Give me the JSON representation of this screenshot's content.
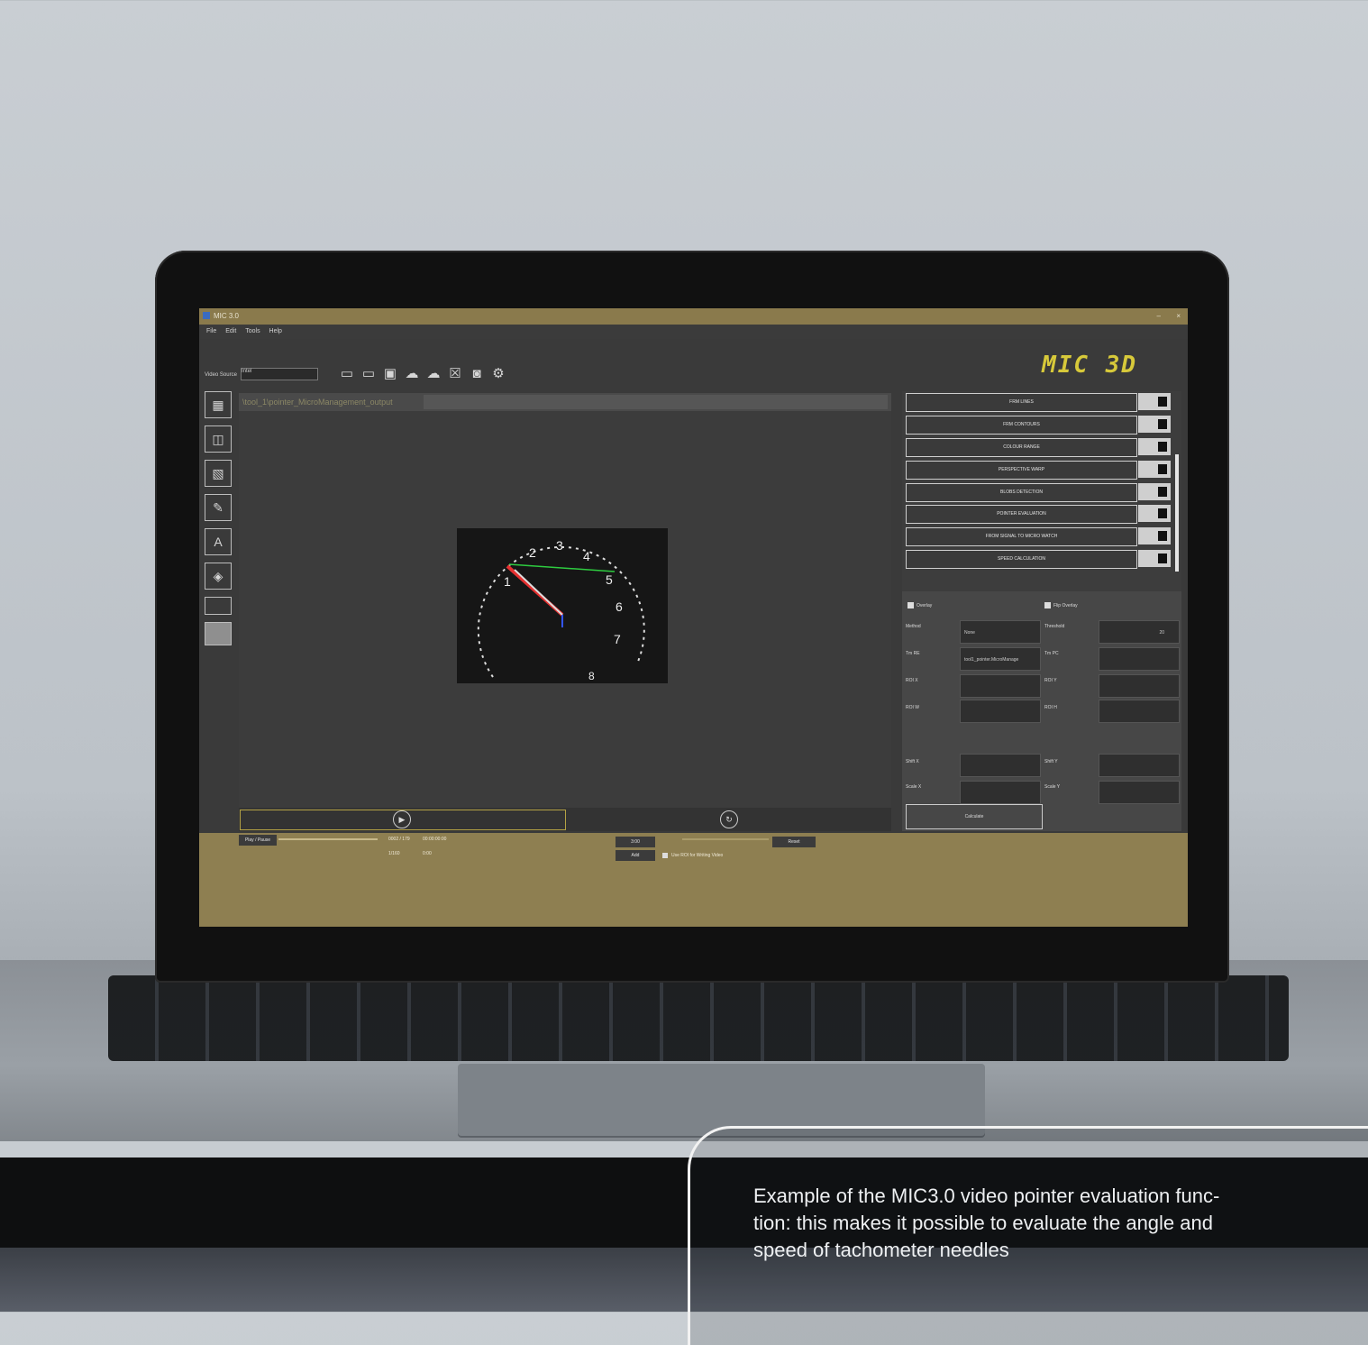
{
  "window": {
    "title": "MIC 3.0"
  },
  "menu": [
    "File",
    "Edit",
    "Tools",
    "Help"
  ],
  "logo": {
    "text": "MIC 3D"
  },
  "toolbar": {
    "video_source_label": "Video Source",
    "video_source_value": "Intel"
  },
  "path": {
    "text": "\\tool_1\\pointer_MicroManagement_output"
  },
  "functions": [
    {
      "label": "FRM LINES"
    },
    {
      "label": "FRM CONTOURS"
    },
    {
      "label": "COLOUR RANGE"
    },
    {
      "label": "PERSPECTIVE WARP"
    },
    {
      "label": "BLOBS DETECTION"
    },
    {
      "label": "POINTER EVALUATION"
    },
    {
      "label": "FROM SIGNAL TO MICRO WATCH"
    },
    {
      "label": "SPEED CALCULATION"
    }
  ],
  "form": {
    "overlay_label": "Overlay",
    "flip_overlay_label": "Flip Overlay",
    "method_label": "Method",
    "method_value": "None",
    "threshold_label": "Threshold",
    "threshold_value": "20",
    "tm_rel_label": "Tm RE",
    "tm_rel_value": "tool1_pointer.MicroManage",
    "tm_pc_label": "Tm PC",
    "roi_x_label": "ROI X",
    "roi_y_label": "ROI Y",
    "roi_w_label": "ROI W",
    "roi_h_label": "ROI H",
    "shift_x_label": "Shift X",
    "shift_y_label": "Shift Y",
    "scale_x_label": "Scale X",
    "scale_y_label": "Scale Y",
    "calculate_label": "Calculate"
  },
  "status": {
    "play_pause_label": "Play / Pause",
    "time_left": "0002 / 179",
    "time_right": "00:00:00:00",
    "count_left": "1/160",
    "count_right": "0:00",
    "fps_value": "3:00",
    "add_label": "Add",
    "use_roi_label": "Use ROI for Writing Video",
    "reset_label": "Reset"
  },
  "gauge": {
    "labels": [
      "1",
      "2",
      "3",
      "4",
      "5",
      "6",
      "7",
      "8"
    ]
  },
  "caption": {
    "text": "Example of the MIC3.0 video pointer evaluation func-\ntion: this makes it possible to evaluate the angle and\nspeed of tachometer needles"
  }
}
